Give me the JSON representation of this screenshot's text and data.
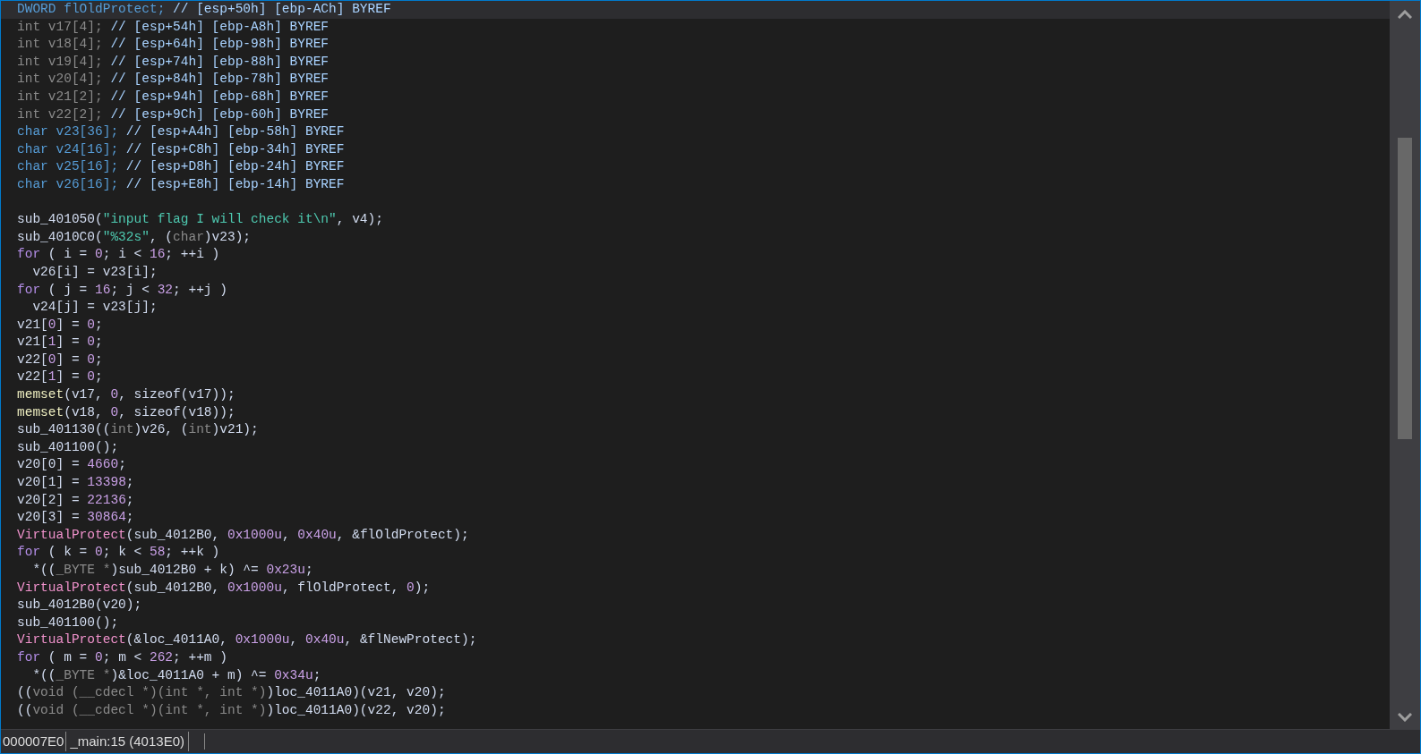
{
  "code_lines": [
    {
      "selected": true,
      "tokens": [
        {
          "kind": "type",
          "text": "DWORD flOldProtect;"
        },
        {
          "kind": "comment",
          "text": " // [esp+50h] [ebp-ACh] BYREF"
        }
      ]
    },
    {
      "selected": false,
      "tokens": [
        {
          "kind": "dim",
          "text": "int v17[4];"
        },
        {
          "kind": "comment",
          "text": " // [esp+54h] [ebp-A8h] BYREF"
        }
      ]
    },
    {
      "selected": false,
      "tokens": [
        {
          "kind": "dim",
          "text": "int v18[4];"
        },
        {
          "kind": "comment",
          "text": " // [esp+64h] [ebp-98h] BYREF"
        }
      ]
    },
    {
      "selected": false,
      "tokens": [
        {
          "kind": "dim",
          "text": "int v19[4];"
        },
        {
          "kind": "comment",
          "text": " // [esp+74h] [ebp-88h] BYREF"
        }
      ]
    },
    {
      "selected": false,
      "tokens": [
        {
          "kind": "dim",
          "text": "int v20[4];"
        },
        {
          "kind": "comment",
          "text": " // [esp+84h] [ebp-78h] BYREF"
        }
      ]
    },
    {
      "selected": false,
      "tokens": [
        {
          "kind": "dim",
          "text": "int v21[2];"
        },
        {
          "kind": "comment",
          "text": " // [esp+94h] [ebp-68h] BYREF"
        }
      ]
    },
    {
      "selected": false,
      "tokens": [
        {
          "kind": "dim",
          "text": "int v22[2];"
        },
        {
          "kind": "comment",
          "text": " // [esp+9Ch] [ebp-60h] BYREF"
        }
      ]
    },
    {
      "selected": false,
      "tokens": [
        {
          "kind": "type",
          "text": "char v23[36];"
        },
        {
          "kind": "comment",
          "text": " // [esp+A4h] [ebp-58h] BYREF"
        }
      ]
    },
    {
      "selected": false,
      "tokens": [
        {
          "kind": "type",
          "text": "char v24[16];"
        },
        {
          "kind": "comment",
          "text": " // [esp+C8h] [ebp-34h] BYREF"
        }
      ]
    },
    {
      "selected": false,
      "tokens": [
        {
          "kind": "type",
          "text": "char v25[16];"
        },
        {
          "kind": "comment",
          "text": " // [esp+D8h] [ebp-24h] BYREF"
        }
      ]
    },
    {
      "selected": false,
      "tokens": [
        {
          "kind": "type",
          "text": "char v26[16];"
        },
        {
          "kind": "comment",
          "text": " // [esp+E8h] [ebp-14h] BYREF"
        }
      ]
    },
    {
      "selected": false
    },
    {
      "selected": false,
      "tokens": [
        {
          "kind": "plain",
          "text": "sub_401050("
        },
        {
          "kind": "string",
          "text": "\"input flag I will check it\\n\""
        },
        {
          "kind": "plain",
          "text": ", v4);"
        }
      ]
    },
    {
      "selected": false,
      "tokens": [
        {
          "kind": "plain",
          "text": "sub_4010C0("
        },
        {
          "kind": "string",
          "text": "\"%32s\""
        },
        {
          "kind": "plain",
          "text": ", ("
        },
        {
          "kind": "dim",
          "text": "char"
        },
        {
          "kind": "plain",
          "text": ")v23);"
        }
      ]
    },
    {
      "selected": false,
      "tokens": [
        {
          "kind": "keyword",
          "text": "for"
        },
        {
          "kind": "plain",
          "text": " ( i = "
        },
        {
          "kind": "number",
          "text": "0"
        },
        {
          "kind": "plain",
          "text": "; i < "
        },
        {
          "kind": "number",
          "text": "16"
        },
        {
          "kind": "plain",
          "text": "; ++i )"
        }
      ]
    },
    {
      "selected": false,
      "tokens": [
        {
          "kind": "plain",
          "text": "  v26[i] = v23[i];"
        }
      ]
    },
    {
      "selected": false,
      "tokens": [
        {
          "kind": "keyword",
          "text": "for"
        },
        {
          "kind": "plain",
          "text": " ( j = "
        },
        {
          "kind": "number",
          "text": "16"
        },
        {
          "kind": "plain",
          "text": "; j < "
        },
        {
          "kind": "number",
          "text": "32"
        },
        {
          "kind": "plain",
          "text": "; ++j )"
        }
      ]
    },
    {
      "selected": false,
      "tokens": [
        {
          "kind": "plain",
          "text": "  v24[j] = v23[j];"
        }
      ]
    },
    {
      "selected": false,
      "tokens": [
        {
          "kind": "plain",
          "text": "v21["
        },
        {
          "kind": "number",
          "text": "0"
        },
        {
          "kind": "plain",
          "text": "] = "
        },
        {
          "kind": "number",
          "text": "0"
        },
        {
          "kind": "plain",
          "text": ";"
        }
      ]
    },
    {
      "selected": false,
      "tokens": [
        {
          "kind": "plain",
          "text": "v21["
        },
        {
          "kind": "number",
          "text": "1"
        },
        {
          "kind": "plain",
          "text": "] = "
        },
        {
          "kind": "number",
          "text": "0"
        },
        {
          "kind": "plain",
          "text": ";"
        }
      ]
    },
    {
      "selected": false,
      "tokens": [
        {
          "kind": "plain",
          "text": "v22["
        },
        {
          "kind": "number",
          "text": "0"
        },
        {
          "kind": "plain",
          "text": "] = "
        },
        {
          "kind": "number",
          "text": "0"
        },
        {
          "kind": "plain",
          "text": ";"
        }
      ]
    },
    {
      "selected": false,
      "tokens": [
        {
          "kind": "plain",
          "text": "v22["
        },
        {
          "kind": "number",
          "text": "1"
        },
        {
          "kind": "plain",
          "text": "] = "
        },
        {
          "kind": "number",
          "text": "0"
        },
        {
          "kind": "plain",
          "text": ";"
        }
      ]
    },
    {
      "selected": false,
      "tokens": [
        {
          "kind": "function",
          "text": "memset"
        },
        {
          "kind": "plain",
          "text": "(v17, "
        },
        {
          "kind": "number",
          "text": "0"
        },
        {
          "kind": "plain",
          "text": ", sizeof(v17));"
        }
      ]
    },
    {
      "selected": false,
      "tokens": [
        {
          "kind": "function",
          "text": "memset"
        },
        {
          "kind": "plain",
          "text": "(v18, "
        },
        {
          "kind": "number",
          "text": "0"
        },
        {
          "kind": "plain",
          "text": ", sizeof(v18));"
        }
      ]
    },
    {
      "selected": false,
      "tokens": [
        {
          "kind": "plain",
          "text": "sub_401130(("
        },
        {
          "kind": "dim",
          "text": "int"
        },
        {
          "kind": "plain",
          "text": ")v26, ("
        },
        {
          "kind": "dim",
          "text": "int"
        },
        {
          "kind": "plain",
          "text": ")v21);"
        }
      ]
    },
    {
      "selected": false,
      "tokens": [
        {
          "kind": "plain",
          "text": "sub_401100();"
        }
      ]
    },
    {
      "selected": false,
      "tokens": [
        {
          "kind": "plain",
          "text": "v20[0] = "
        },
        {
          "kind": "number",
          "text": "4660"
        },
        {
          "kind": "plain",
          "text": ";"
        }
      ]
    },
    {
      "selected": false,
      "tokens": [
        {
          "kind": "plain",
          "text": "v20[1] = "
        },
        {
          "kind": "number",
          "text": "13398"
        },
        {
          "kind": "plain",
          "text": ";"
        }
      ]
    },
    {
      "selected": false,
      "tokens": [
        {
          "kind": "plain",
          "text": "v20[2] = "
        },
        {
          "kind": "number",
          "text": "22136"
        },
        {
          "kind": "plain",
          "text": ";"
        }
      ]
    },
    {
      "selected": false,
      "tokens": [
        {
          "kind": "plain",
          "text": "v20[3] = "
        },
        {
          "kind": "number",
          "text": "30864"
        },
        {
          "kind": "plain",
          "text": ";"
        }
      ]
    },
    {
      "selected": false,
      "tokens": [
        {
          "kind": "api",
          "text": "VirtualProtect"
        },
        {
          "kind": "plain",
          "text": "(sub_4012B0, "
        },
        {
          "kind": "number",
          "text": "0x1000u"
        },
        {
          "kind": "plain",
          "text": ", "
        },
        {
          "kind": "number",
          "text": "0x40u"
        },
        {
          "kind": "plain",
          "text": ", &flOldProtect);"
        }
      ]
    },
    {
      "selected": false,
      "tokens": [
        {
          "kind": "keyword",
          "text": "for"
        },
        {
          "kind": "plain",
          "text": " ( k = "
        },
        {
          "kind": "number",
          "text": "0"
        },
        {
          "kind": "plain",
          "text": "; k < "
        },
        {
          "kind": "number",
          "text": "58"
        },
        {
          "kind": "plain",
          "text": "; ++k )"
        }
      ]
    },
    {
      "selected": false,
      "tokens": [
        {
          "kind": "plain",
          "text": "  *(("
        },
        {
          "kind": "dim",
          "text": "_BYTE *"
        },
        {
          "kind": "plain",
          "text": ")sub_4012B0 + k) ^= "
        },
        {
          "kind": "number",
          "text": "0x23u"
        },
        {
          "kind": "plain",
          "text": ";"
        }
      ]
    },
    {
      "selected": false,
      "tokens": [
        {
          "kind": "api",
          "text": "VirtualProtect"
        },
        {
          "kind": "plain",
          "text": "(sub_4012B0, "
        },
        {
          "kind": "number",
          "text": "0x1000u"
        },
        {
          "kind": "plain",
          "text": ", flOldProtect, "
        },
        {
          "kind": "number",
          "text": "0"
        },
        {
          "kind": "plain",
          "text": ");"
        }
      ]
    },
    {
      "selected": false,
      "tokens": [
        {
          "kind": "plain",
          "text": "sub_4012B0(v20);"
        }
      ]
    },
    {
      "selected": false,
      "tokens": [
        {
          "kind": "plain",
          "text": "sub_401100();"
        }
      ]
    },
    {
      "selected": false,
      "tokens": [
        {
          "kind": "api",
          "text": "VirtualProtect"
        },
        {
          "kind": "plain",
          "text": "(&loc_4011A0, "
        },
        {
          "kind": "number",
          "text": "0x1000u"
        },
        {
          "kind": "plain",
          "text": ", "
        },
        {
          "kind": "number",
          "text": "0x40u"
        },
        {
          "kind": "plain",
          "text": ", &flNewProtect);"
        }
      ]
    },
    {
      "selected": false,
      "tokens": [
        {
          "kind": "keyword",
          "text": "for"
        },
        {
          "kind": "plain",
          "text": " ( m = "
        },
        {
          "kind": "number",
          "text": "0"
        },
        {
          "kind": "plain",
          "text": "; m < "
        },
        {
          "kind": "number",
          "text": "262"
        },
        {
          "kind": "plain",
          "text": "; ++m )"
        }
      ]
    },
    {
      "selected": false,
      "tokens": [
        {
          "kind": "plain",
          "text": "  *(("
        },
        {
          "kind": "dim",
          "text": "_BYTE *"
        },
        {
          "kind": "plain",
          "text": ")&loc_4011A0 + m) ^= "
        },
        {
          "kind": "number",
          "text": "0x34u"
        },
        {
          "kind": "plain",
          "text": ";"
        }
      ]
    },
    {
      "selected": false,
      "tokens": [
        {
          "kind": "plain",
          "text": "(("
        },
        {
          "kind": "dim",
          "text": "void (__cdecl *)(int *, int *)"
        },
        {
          "kind": "plain",
          "text": ")loc_4011A0)(v21, v20);"
        }
      ]
    },
    {
      "selected": false,
      "tokens": [
        {
          "kind": "plain",
          "text": "(("
        },
        {
          "kind": "dim",
          "text": "void (__cdecl *)(int *, int *)"
        },
        {
          "kind": "plain",
          "text": ")loc_4011A0)(v22, v20);"
        }
      ]
    }
  ],
  "status_bar": {
    "offset": "000007E0",
    "location": "_main:15 (4013E0)"
  }
}
